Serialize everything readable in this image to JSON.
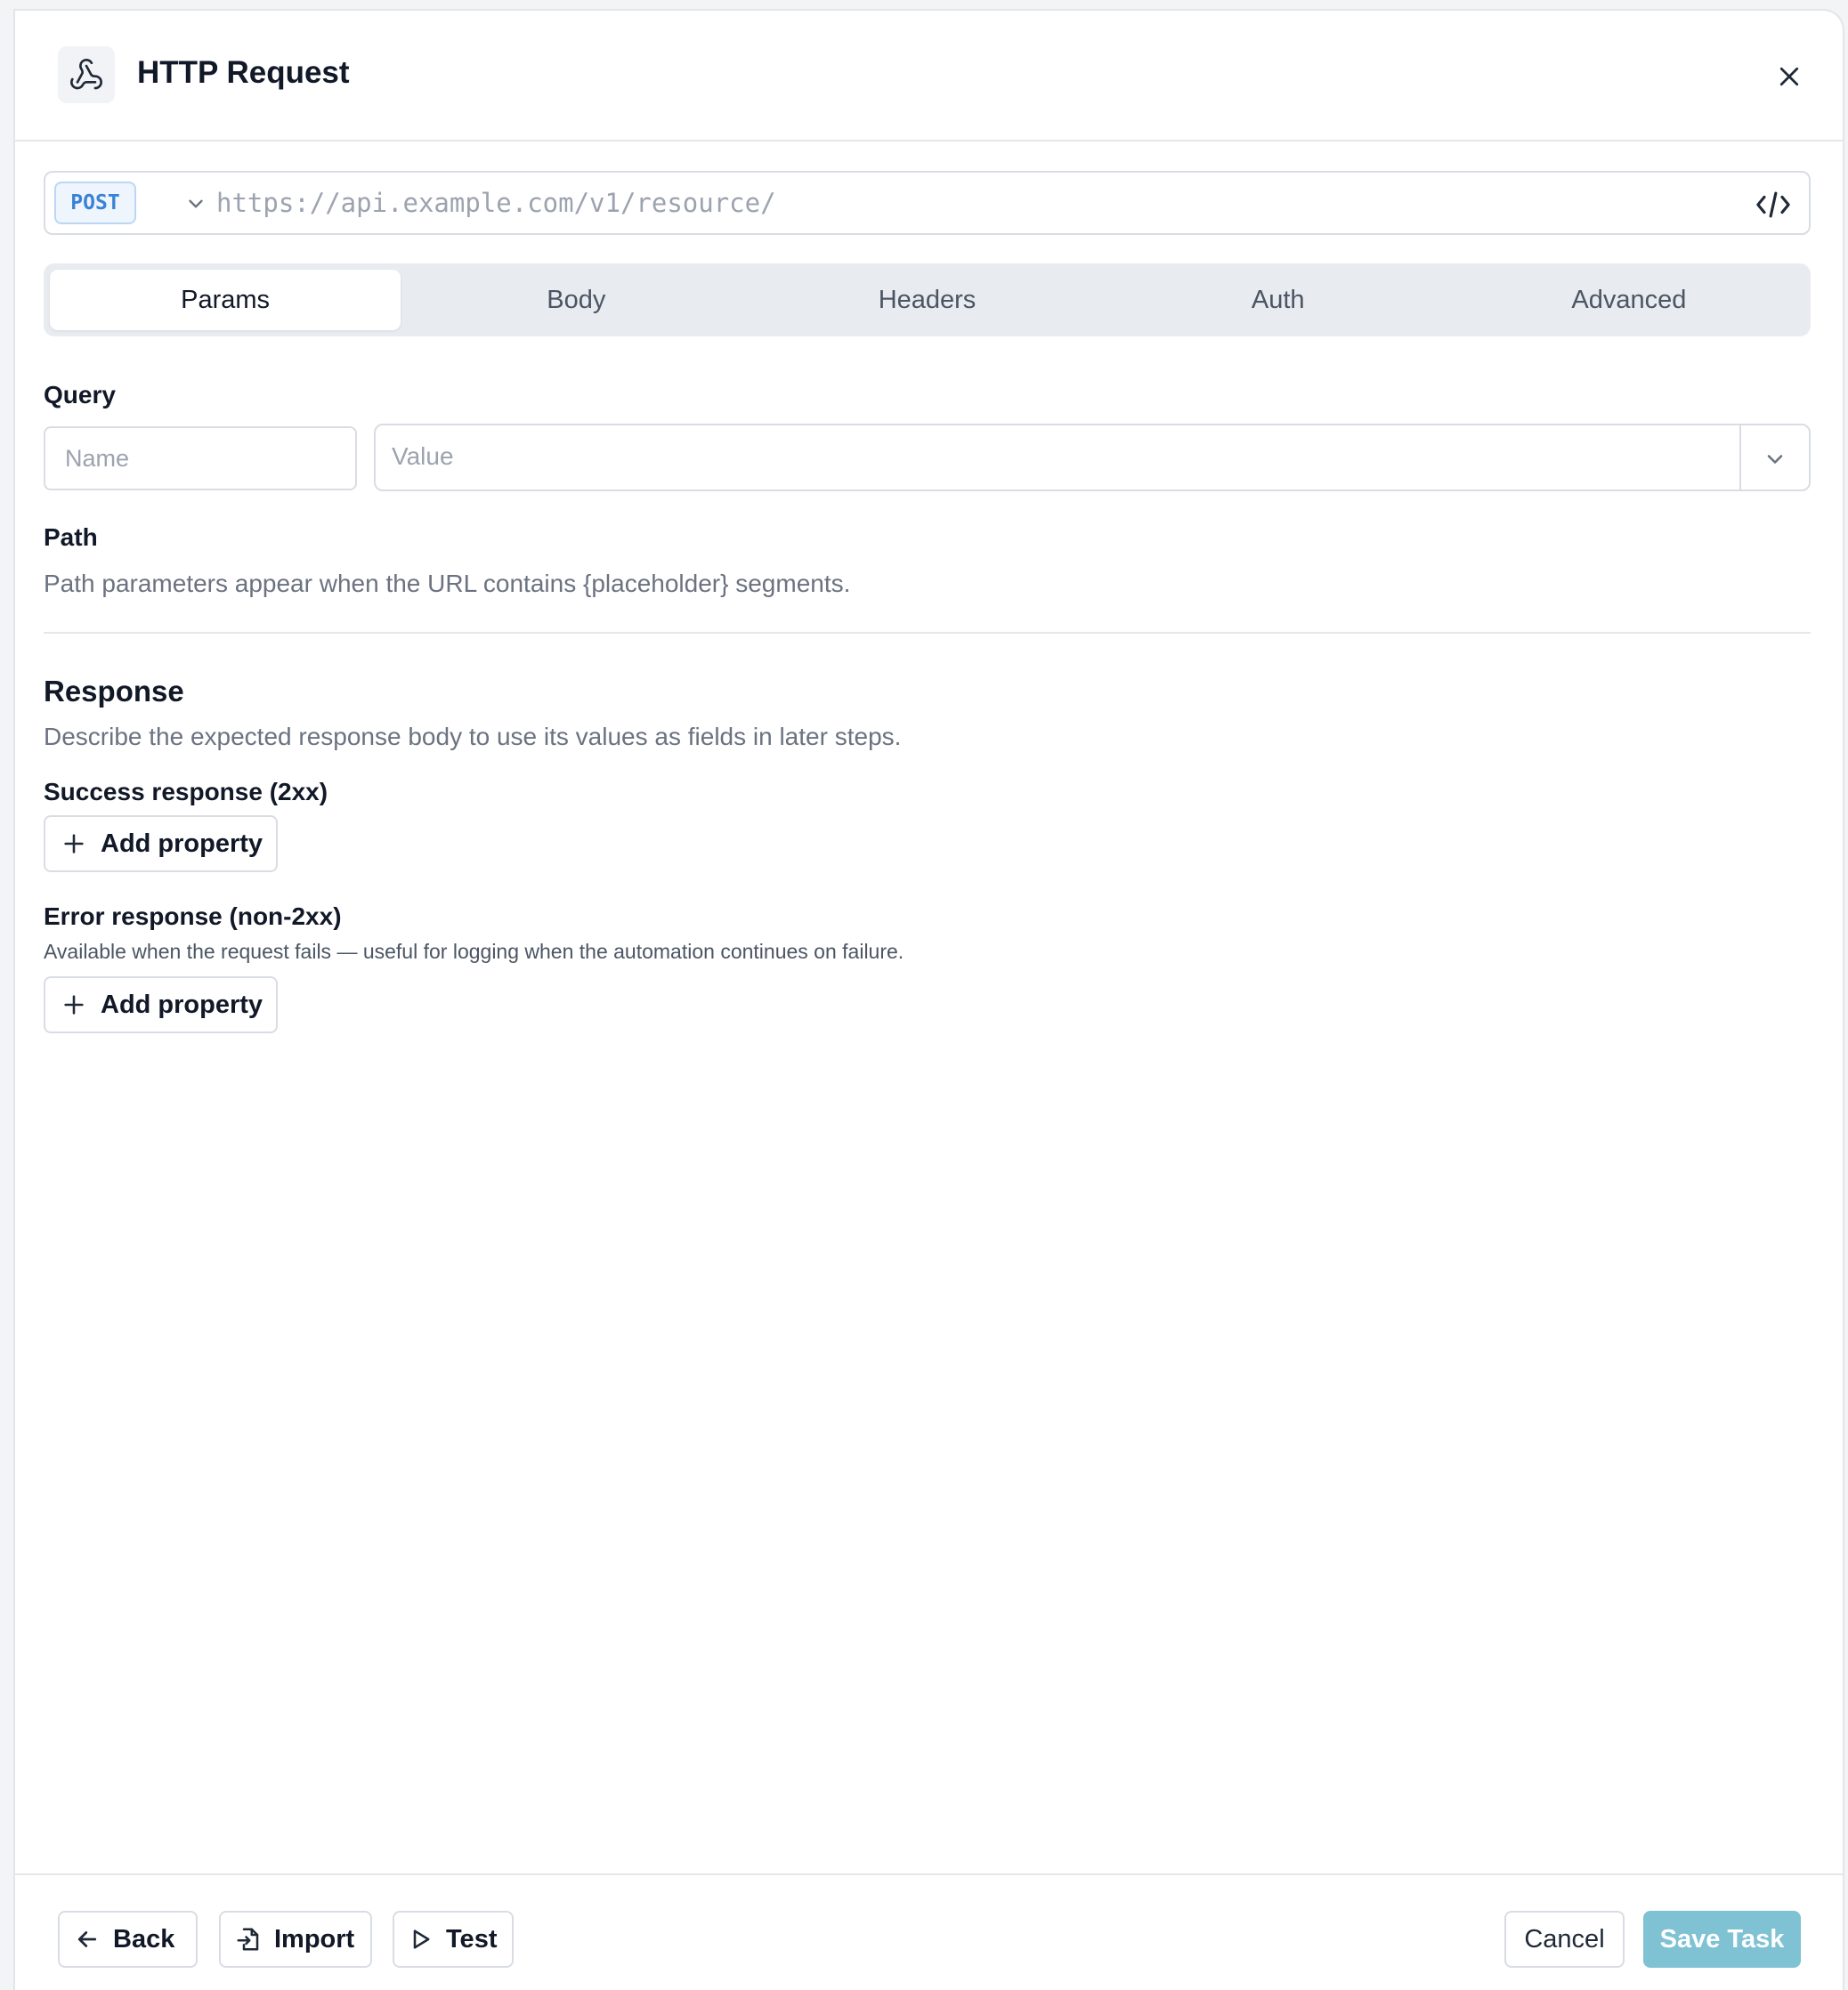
{
  "header": {
    "title": "HTTP Request",
    "icon": "webhook-icon",
    "close_icon": "close-icon"
  },
  "request": {
    "method": "POST",
    "url_placeholder": "https://api.example.com/v1/resource/",
    "code_icon": "code-icon"
  },
  "tabs": [
    {
      "label": "Params",
      "active": true
    },
    {
      "label": "Body",
      "active": false
    },
    {
      "label": "Headers",
      "active": false
    },
    {
      "label": "Auth",
      "active": false
    },
    {
      "label": "Advanced",
      "active": false
    }
  ],
  "query": {
    "label": "Query",
    "name_placeholder": "Name",
    "value_placeholder": "Value"
  },
  "path": {
    "label": "Path",
    "help": "Path parameters appear when the URL contains {placeholder} segments."
  },
  "response": {
    "title": "Response",
    "description": "Describe the expected response body to use its values as fields in later steps.",
    "success_label": "Success response (2xx)",
    "error_label": "Error response (non-2xx)",
    "error_help": "Available when the request fails — useful for logging when the automation continues on failure.",
    "add_property_label": "Add property"
  },
  "footer": {
    "back": "Back",
    "import": "Import",
    "test": "Test",
    "cancel": "Cancel",
    "save": "Save Task"
  },
  "colors": {
    "accent_disabled": "#7ec2d3",
    "method_badge": "#3b82d6",
    "tab_bg": "#e8ecf0"
  }
}
